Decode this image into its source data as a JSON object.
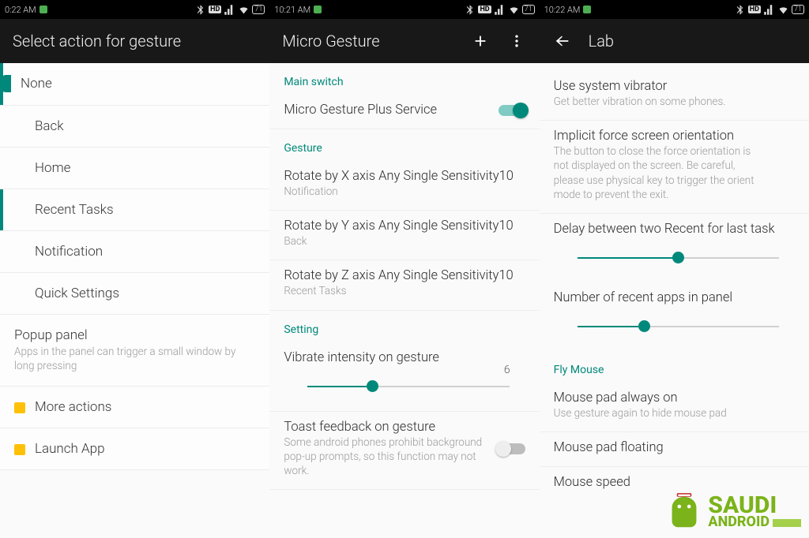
{
  "pane1": {
    "status_time": "0:22 AM",
    "title": "Select action for gesture",
    "items": [
      {
        "label": "None",
        "selected": true,
        "tick": false,
        "sub": ""
      },
      {
        "label": "Back",
        "selected": false,
        "tick": false,
        "sub": ""
      },
      {
        "label": "Home",
        "selected": false,
        "tick": false,
        "sub": ""
      },
      {
        "label": "Recent Tasks",
        "selected": true,
        "tick": false,
        "sub": ""
      },
      {
        "label": "Notification",
        "selected": false,
        "tick": false,
        "sub": ""
      },
      {
        "label": "Quick Settings",
        "selected": false,
        "tick": false,
        "sub": ""
      },
      {
        "label": "Popup panel",
        "selected": false,
        "tick": false,
        "sub": "Apps in the panel can trigger a small window by long pressing"
      },
      {
        "label": "More actions",
        "selected": false,
        "tick": true,
        "sub": ""
      },
      {
        "label": "Launch App",
        "selected": false,
        "tick": true,
        "sub": ""
      }
    ]
  },
  "pane2": {
    "status_time": "10:21 AM",
    "title": "Micro Gesture",
    "section_main": "Main switch",
    "main_service": "Micro Gesture Plus Service",
    "section_gesture": "Gesture",
    "gestures": [
      {
        "title": "Rotate by X axis Any Single Sensitivity10",
        "sub": "Notification"
      },
      {
        "title": "Rotate by Y axis Any Single Sensitivity10",
        "sub": "Back"
      },
      {
        "title": "Rotate by Z axis Any Single Sensitivity10",
        "sub": "Recent Tasks"
      }
    ],
    "section_setting": "Setting",
    "vibrate_title": "Vibrate intensity on gesture",
    "vibrate_value": "6",
    "toast_title": "Toast feedback on gesture",
    "toast_sub": "Some android phones prohibit background pop-up prompts, so this function may not work."
  },
  "pane3": {
    "status_time": "10:22 AM",
    "title": "Lab",
    "sysvib_title": "Use system vibrator",
    "sysvib_sub": "Get better vibration on some phones.",
    "orient_title": "Implicit force screen orientation",
    "orient_sub": "The button to close the force orientation is not displayed on the screen. Be careful, please use physical key to trigger the orient mode to prevent the exit.",
    "delay_title": "Delay between two Recent for last task",
    "recent_title": "Number of recent apps in panel",
    "section_fly": "Fly Mouse",
    "mpad_on_title": "Mouse pad always on",
    "mpad_on_sub": "Use gesture again to hide mouse pad",
    "mpad_float_title": "Mouse pad floating",
    "mspeed_title": "Mouse speed"
  },
  "watermark": {
    "top": "SAUDI",
    "bot": "ANDROID"
  },
  "status_icons": {
    "battery": "71"
  }
}
